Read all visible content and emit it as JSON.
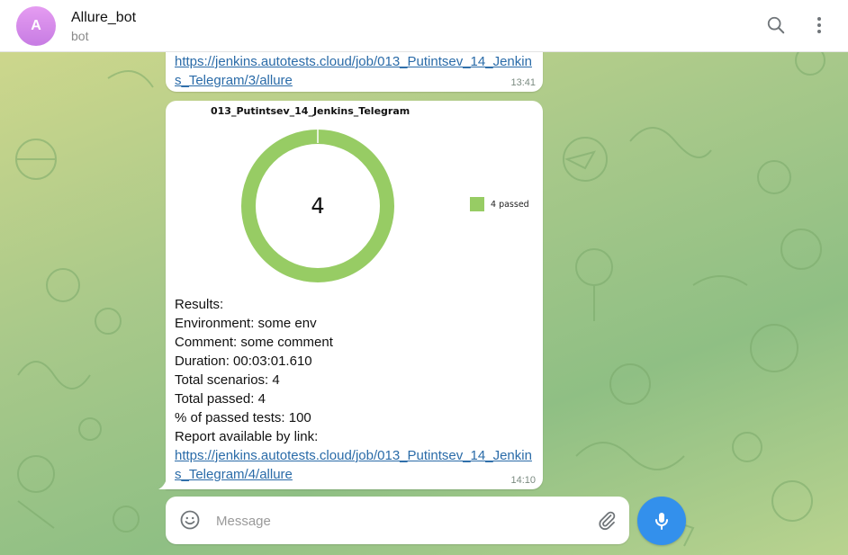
{
  "header": {
    "avatar_letter": "A",
    "title": "Allure_bot",
    "subtitle": "bot",
    "search_icon": "search-icon",
    "menu_icon": "more-vertical-icon"
  },
  "messages": [
    {
      "link": "https://jenkins.autotests.cloud/job/013_Putintsev_14_Jenkins_Telegram/3/allure",
      "time": "13:41"
    },
    {
      "chart_title": "013_Putintsev_14_Jenkins_Telegram",
      "chart_center": "4",
      "results_heading": "Results:",
      "fields": [
        {
          "key": "Environment:",
          "value": "some env"
        },
        {
          "key": "Comment:",
          "value": "some comment"
        },
        {
          "key": "Duration:",
          "value": "00:03:01.610"
        },
        {
          "key": "Total scenarios:",
          "value": "4"
        },
        {
          "key": "Total passed:",
          "value": "4"
        },
        {
          "key": "% of passed tests:",
          "value": "100"
        }
      ],
      "report_label": "Report available by link:",
      "link": "https://jenkins.autotests.cloud/job/013_Putintsev_14_Jenkins_Telegram/4/allure",
      "time": "14:10"
    }
  ],
  "chart_data": {
    "type": "pie",
    "title": "013_Putintsev_14_Jenkins_Telegram",
    "center_label": "4",
    "slices": [
      {
        "name": "4 passed",
        "value": 4,
        "color": "#97cc64"
      }
    ],
    "legend_position": "right"
  },
  "composer": {
    "placeholder": "Message",
    "emoji_icon": "emoji-icon",
    "attach_icon": "paperclip-icon",
    "mic_icon": "microphone-icon"
  },
  "colors": {
    "accent": "#3390ec",
    "passed": "#97cc64",
    "link": "#2a6ba8"
  }
}
